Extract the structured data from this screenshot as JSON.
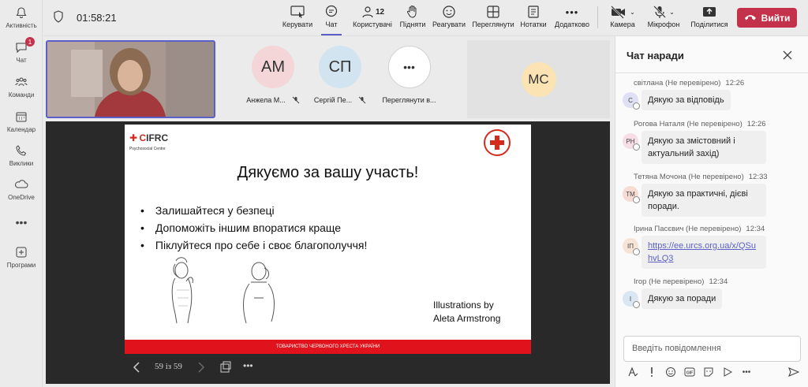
{
  "rail": {
    "items": [
      {
        "label": "Активність",
        "icon": "bell-icon"
      },
      {
        "label": "Чат",
        "icon": "chat-icon",
        "badge": "1"
      },
      {
        "label": "Команди",
        "icon": "teams-icon"
      },
      {
        "label": "Календар",
        "icon": "calendar-icon"
      },
      {
        "label": "Виклики",
        "icon": "phone-icon"
      },
      {
        "label": "OneDrive",
        "icon": "cloud-icon"
      },
      {
        "label": "",
        "icon": "more-icon"
      },
      {
        "label": "Програми",
        "icon": "add-app-icon"
      }
    ]
  },
  "topbar": {
    "timer": "01:58:21",
    "buttons": [
      {
        "label": "Керувати",
        "icon": "manage-icon"
      },
      {
        "label": "Чат",
        "icon": "chat-icon"
      },
      {
        "label": "Користувачі",
        "icon": "people-icon",
        "count": "12"
      },
      {
        "label": "Підняти",
        "icon": "hand-icon"
      },
      {
        "label": "Реагувати",
        "icon": "smile-icon"
      },
      {
        "label": "Переглянути",
        "icon": "view-icon"
      },
      {
        "label": "Нотатки",
        "icon": "notes-icon"
      },
      {
        "label": "Додатково",
        "icon": "more-icon"
      },
      {
        "label": "Камера",
        "icon": "camera-off-icon"
      },
      {
        "label": "Мікрофон",
        "icon": "mic-off-icon"
      },
      {
        "label": "Поділитися",
        "icon": "share-icon"
      }
    ],
    "leave_label": "Вийти"
  },
  "participants": [
    {
      "initials": "АМ",
      "name": "Анжела М...",
      "color": "#f4d6d9"
    },
    {
      "initials": "СП",
      "name": "Сергій Пе...",
      "color": "#d2e4ef"
    },
    {
      "initials": "•••",
      "name": "Переглянути в...",
      "color": "#ffffff"
    },
    {
      "initials": "МС",
      "name": "",
      "color": "#fbe3b3"
    }
  ],
  "slide": {
    "logo": "IFRC",
    "logo_sub": "Psychosocial Centre",
    "title": "Дякуємо за вашу участь!",
    "bullets": [
      "Залишайтеся у безпеці",
      "Допоможіть іншим впоратися краще",
      "Піклуйтеся про себе і своє благополуччя!"
    ],
    "credit_line1": "Illustrations by",
    "credit_line2": "Aleta Armstrong",
    "footer": "ТОВАРИСТВО ЧЕРВОНОГО ХРЕСТА УКРАЇНИ",
    "page": "59 із 59"
  },
  "chat": {
    "title": "Чат наради",
    "messages": [
      {
        "author": "світлана (Не перевірено)",
        "time": "12:26",
        "initials": "С",
        "av_color": "#dfe0f3",
        "text": "Дякую за відповідь"
      },
      {
        "author": "Рогова Наталя (Не перевірено)",
        "time": "12:26",
        "initials": "РН",
        "av_color": "#f6dde6",
        "text": "Дякую за змістовний і актуальний захід)"
      },
      {
        "author": "Тетяна Мочона (Не перевірено)",
        "time": "12:33",
        "initials": "ТМ",
        "av_color": "#f7dcd3",
        "text": "Дякую за практичні, дієві поради."
      },
      {
        "author": "Ірина Пасєвич (Не перевірено)",
        "time": "12:34",
        "initials": "ІП",
        "av_color": "#f6e5d6",
        "text": "https://ee.urcs.org.ua/x/QSuhvLQ3"
      },
      {
        "author": "Ігор (Не перевірено)",
        "time": "12:34",
        "initials": "І",
        "av_color": "#dbe6f3",
        "text": "Дякую за поради"
      }
    ],
    "placeholder": "Введіть повідомлення"
  }
}
